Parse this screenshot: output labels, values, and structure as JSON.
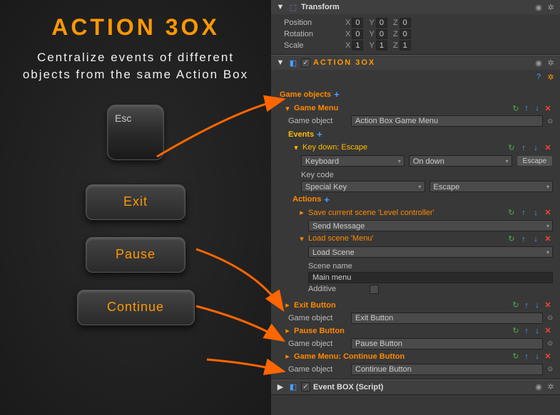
{
  "logo": "ACTION 3OX",
  "tagline": "Centralize events of different objects from the same Action Box",
  "left_buttons": {
    "esc": "Esc",
    "exit": "Exit",
    "pause": "Pause",
    "continue": "Continue"
  },
  "transform": {
    "title": "Transform",
    "rows": [
      {
        "label": "Position",
        "x": "0",
        "y": "0",
        "z": "0"
      },
      {
        "label": "Rotation",
        "x": "0",
        "y": "0",
        "z": "0"
      },
      {
        "label": "Scale",
        "x": "1",
        "y": "1",
        "z": "1"
      }
    ]
  },
  "actionbox": {
    "title": "ACTION 3OX",
    "game_objects_label": "Game objects",
    "items": [
      {
        "label": "Game Menu",
        "game_object": "Action Box Game Menu",
        "go_label": "Game object",
        "events_label": "Events",
        "events": [
          {
            "label": "Key down: Escape",
            "type": "Keyboard",
            "trigger": "On down",
            "button": "Escape",
            "keycode_label": "Key code",
            "keycode_type": "Special Key",
            "keycode_val": "Escape",
            "actions_label": "Actions",
            "actions": [
              {
                "label": "Save current scene 'Level controller'",
                "method": "Send Message",
                "expanded": false
              },
              {
                "label": "Load scene 'Menu'",
                "method": "Load Scene",
                "expanded": true,
                "scene_name_label": "Scene name",
                "scene_name": "Main menu",
                "additive_label": "Additive",
                "additive": false
              }
            ]
          }
        ]
      },
      {
        "label": "Exit Button",
        "game_object": "Exit Button",
        "go_label": "Game object"
      },
      {
        "label": "Pause Button",
        "game_object": "Pause Button",
        "go_label": "Game object"
      },
      {
        "label": "Game Menu: Continue Button",
        "game_object": "Continue Button",
        "go_label": "Game object"
      }
    ]
  },
  "eventbox": {
    "title": "Event BOX (Script)"
  }
}
